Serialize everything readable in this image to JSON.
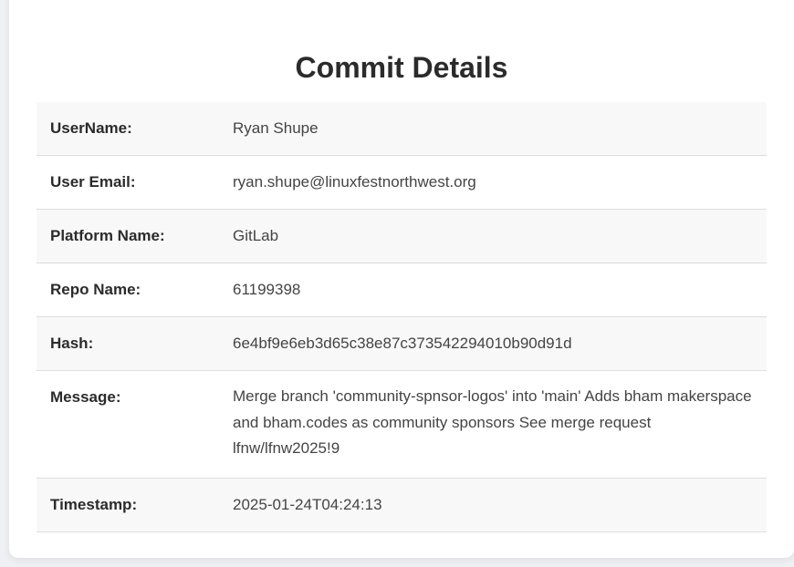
{
  "page": {
    "title": "Commit Details"
  },
  "details": [
    {
      "label": "UserName:",
      "value": "Ryan Shupe"
    },
    {
      "label": "User Email:",
      "value": "ryan.shupe@linuxfestnorthwest.org"
    },
    {
      "label": "Platform Name:",
      "value": "GitLab"
    },
    {
      "label": "Repo Name:",
      "value": "61199398"
    },
    {
      "label": "Hash:",
      "value": "6e4bf9e6eb3d65c38e87c373542294010b90d91d"
    },
    {
      "label": "Message:",
      "value": "Merge branch 'community-spnsor-logos' into 'main' Adds bham makerspace and bham.codes as community sponsors See merge request lfnw/lfnw2025!9"
    },
    {
      "label": "Timestamp:",
      "value": "2025-01-24T04:24:13"
    }
  ]
}
